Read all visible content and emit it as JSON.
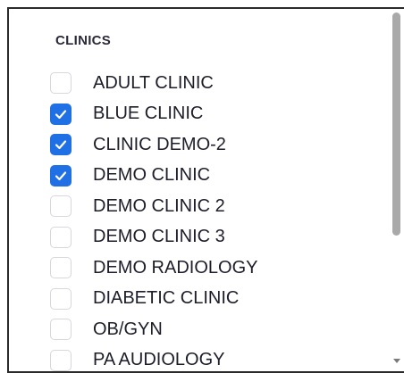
{
  "section": {
    "title": "CLINICS"
  },
  "clinics": [
    {
      "label": "ADULT CLINIC",
      "checked": false
    },
    {
      "label": "BLUE CLINIC",
      "checked": true
    },
    {
      "label": "CLINIC DEMO-2",
      "checked": true
    },
    {
      "label": "DEMO CLINIC",
      "checked": true
    },
    {
      "label": "DEMO CLINIC 2",
      "checked": false
    },
    {
      "label": "DEMO CLINIC 3",
      "checked": false
    },
    {
      "label": "DEMO RADIOLOGY",
      "checked": false
    },
    {
      "label": "DIABETIC CLINIC",
      "checked": false
    },
    {
      "label": "OB/GYN",
      "checked": false
    },
    {
      "label": "PA AUDIOLOGY",
      "checked": false
    }
  ],
  "colors": {
    "checked": "#1f6fe5",
    "border": "#2b2b2b",
    "text": "#1d1d2b"
  },
  "icons": {
    "check": "checkmark-icon",
    "scroll_down": "scroll-down-arrow-icon"
  }
}
